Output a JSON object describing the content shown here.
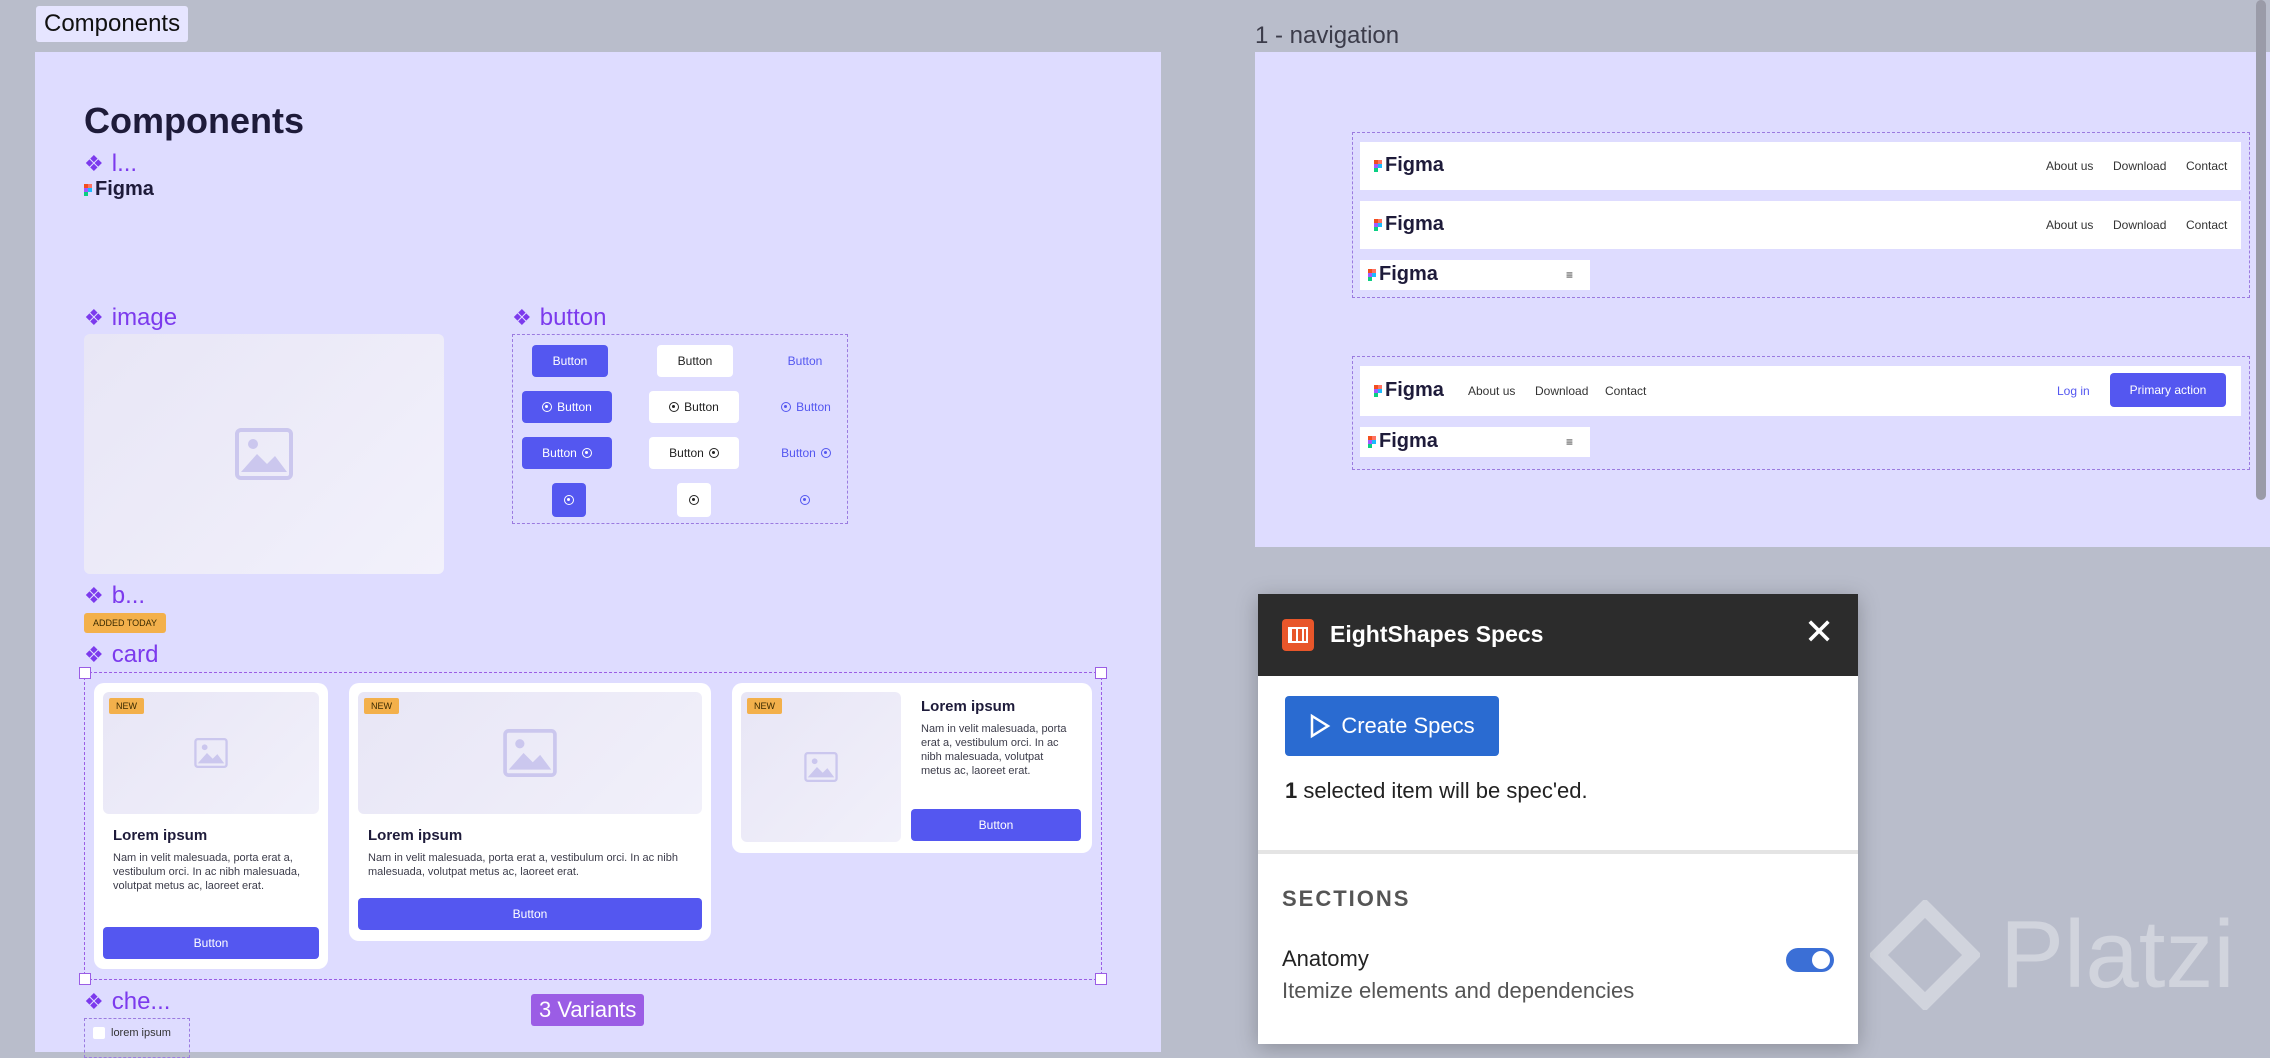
{
  "canvas": {
    "components_tag": "Components",
    "navigation_frame_label": "1 - navigation"
  },
  "components_frame": {
    "heading": "Components",
    "logo_component": {
      "label": "l...",
      "logo_text": "Figma"
    },
    "image_component": {
      "label": "image",
      "icon": "image-placeholder-icon"
    },
    "button_component": {
      "label": "button",
      "button_text": "Button"
    },
    "badge_component": {
      "label": "b...",
      "badge_text": "ADDED TODAY"
    },
    "card_component": {
      "label": "card",
      "cards": [
        {
          "badge": "NEW",
          "title": "Lorem ipsum",
          "body": "Nam in velit malesuada, porta erat a, vestibulum orci. In ac nibh malesuada, volutpat metus ac, laoreet erat.",
          "button": "Button"
        },
        {
          "badge": "NEW",
          "title": "Lorem ipsum",
          "body": "Nam in velit malesuada, porta erat a, vestibulum orci. In ac nibh malesuada, volutpat metus ac, laoreet erat.",
          "button": "Button"
        },
        {
          "badge": "NEW",
          "title": "Lorem ipsum",
          "body": "Nam in velit malesuada, porta erat a, vestibulum orci. In ac nibh malesuada, volutpat metus ac, laoreet erat.",
          "button": "Button"
        }
      ]
    },
    "checkbox_component": {
      "label": "che...",
      "item_text": "lorem ipsum"
    },
    "variants_badge": "3 Variants"
  },
  "navigation": {
    "logo_text": "Figma",
    "links": [
      "About us",
      "Download",
      "Contact"
    ],
    "login": "Log in",
    "primary_action": "Primary action",
    "menu_icon": "hamburger-icon"
  },
  "plugin": {
    "title": "EightShapes Specs",
    "create_button": "Create Specs",
    "selected_count": "1",
    "selected_text": "selected item will be spec'ed.",
    "sections_heading": "SECTIONS",
    "anatomy": {
      "label": "Anatomy",
      "description": "Itemize elements and dependencies",
      "enabled": true
    }
  },
  "watermark": "Platzi",
  "colors": {
    "accent": "#5457f0",
    "frame_bg": "#dedcff",
    "component_purple": "#7c3aed",
    "plugin_blue": "#2a6bd1",
    "badge_orange": "#f3b04b"
  }
}
